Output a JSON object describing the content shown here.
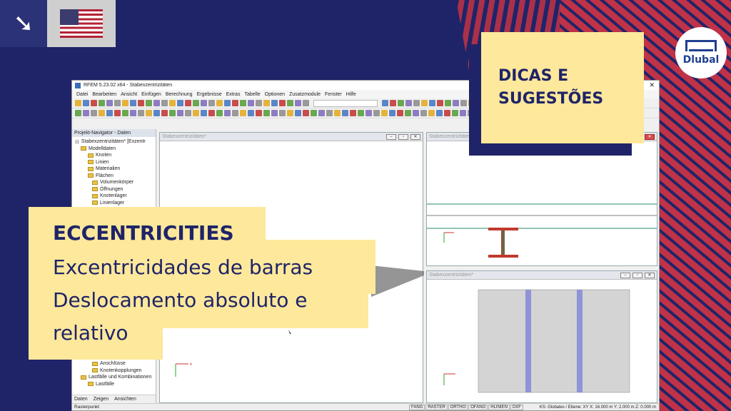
{
  "brand": {
    "logo_text": "Dlubal"
  },
  "badges": {
    "arrow_glyph": "➘",
    "flag": "us-flag-icon"
  },
  "app": {
    "title": "RFEM 5.23.02 x64 - Stabexzentrizitäten",
    "menu": [
      "Datei",
      "Bearbeiten",
      "Ansicht",
      "Einfügen",
      "Berechnung",
      "Ergebnisse",
      "Extras",
      "Tabelle",
      "Optionen",
      "Zusatzmodule",
      "Fenster",
      "Hilfe"
    ],
    "navigator": {
      "header": "Projekt-Navigator - Daten",
      "root": "Stabexzentrizitäten* [Exzentr",
      "items": [
        "Modelldaten",
        "Knoten",
        "Linien",
        "Materialien",
        "Flächen",
        "Volumenkörper",
        "Öffnungen",
        "Knotenlager",
        "Linienlager"
      ],
      "items_lower": [
        "Anschlüsse",
        "Knotenkopplungen",
        "Lastfälle und Kombinationen",
        "Lastfälle"
      ],
      "tabs": [
        "Daten",
        "Zeigen",
        "Ansichten"
      ]
    },
    "views": [
      {
        "title": "Stabexzentrizitäten*"
      },
      {
        "title": "Stabexzentrizitäten*"
      },
      {
        "title": "Stabexzentrizitäten*"
      }
    ],
    "status": {
      "left": "Rasterpunkt",
      "toggles": [
        "FANG",
        "RASTER",
        "ORTHO",
        "OFANG",
        "HLINIEN",
        "DXF"
      ],
      "right": "KS: Globales / Ebene: XY    X: 16.000 m  Y: 2.000 m  Z: 0.000 m"
    }
  },
  "tips": {
    "line1": "DICAS E",
    "line2": "SUGESTÕES"
  },
  "topic": {
    "line1": "ECCENTRICITIES",
    "line2": "Excentricidades de barras",
    "line3": "Deslocamento absoluto e",
    "line4": "relativo"
  }
}
